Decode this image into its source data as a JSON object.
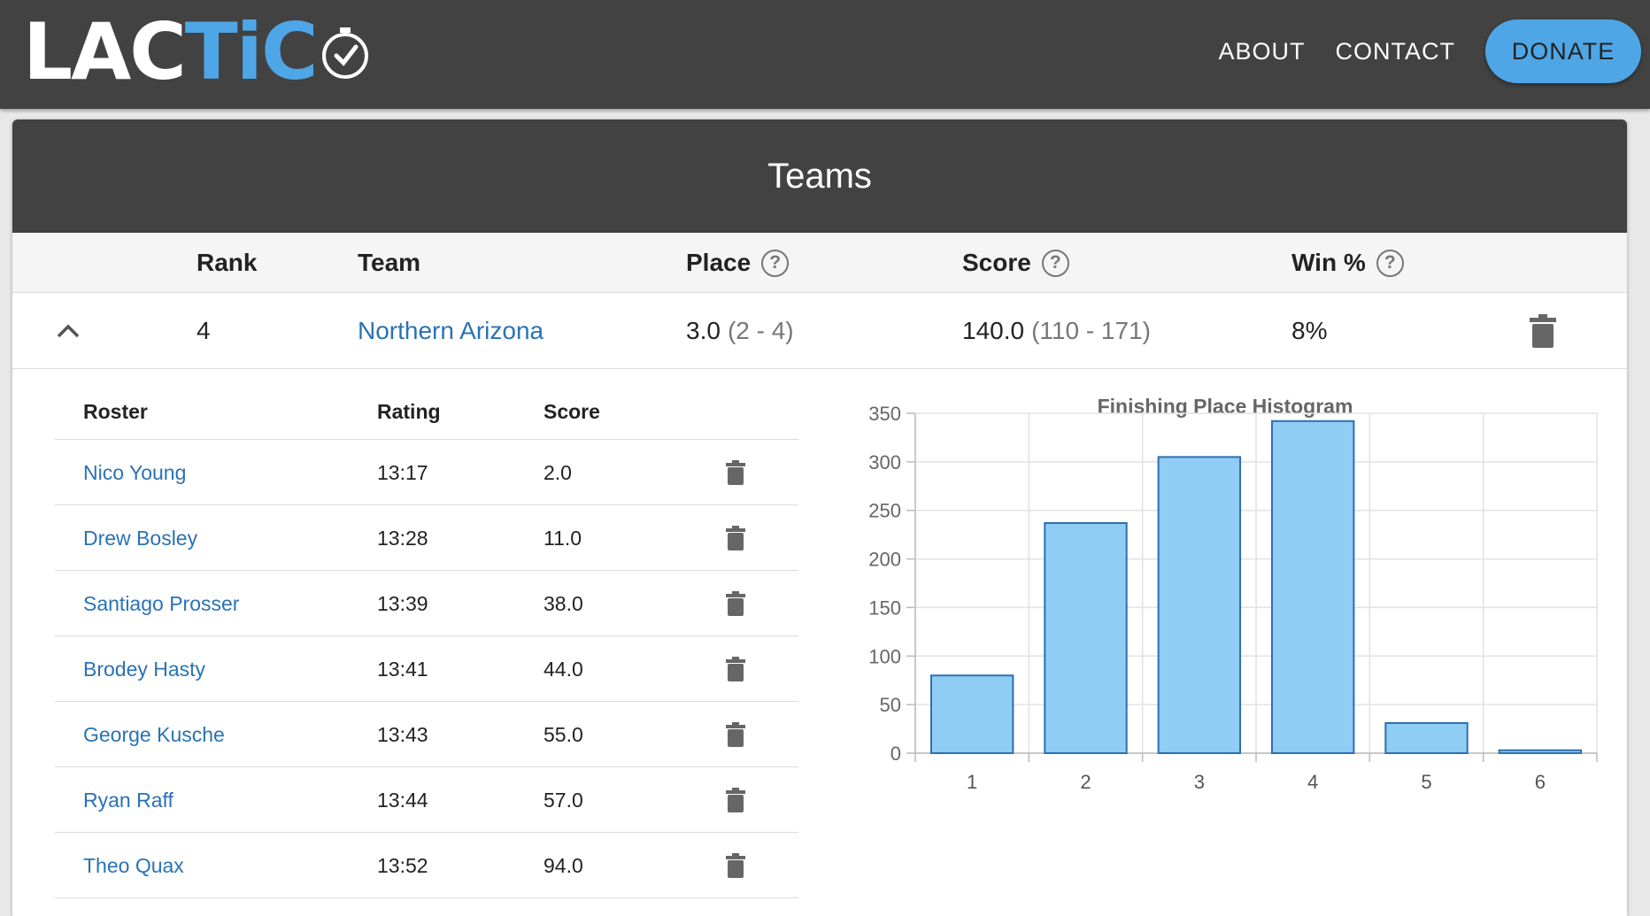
{
  "nav": {
    "logo": {
      "part1": "LA",
      "part2": "C",
      "part3": "TiC"
    },
    "links": [
      "ABOUT",
      "CONTACT"
    ],
    "donate": "DONATE"
  },
  "card": {
    "title": "Teams",
    "columns": {
      "rank": "Rank",
      "team": "Team",
      "place": "Place",
      "score": "Score",
      "win": "Win %"
    },
    "help_glyph": "?"
  },
  "team": {
    "rank": "4",
    "name": "Northern Arizona",
    "place": "3.0",
    "place_range": "(2 - 4)",
    "score": "140.0",
    "score_range": "(110 - 171)",
    "win": "8%"
  },
  "roster": {
    "headers": {
      "name": "Roster",
      "rating": "Rating",
      "score": "Score"
    },
    "rows": [
      {
        "name": "Nico Young",
        "rating": "13:17",
        "score": "2.0"
      },
      {
        "name": "Drew Bosley",
        "rating": "13:28",
        "score": "11.0"
      },
      {
        "name": "Santiago Prosser",
        "rating": "13:39",
        "score": "38.0"
      },
      {
        "name": "Brodey Hasty",
        "rating": "13:41",
        "score": "44.0"
      },
      {
        "name": "George Kusche",
        "rating": "13:43",
        "score": "55.0"
      },
      {
        "name": "Ryan Raff",
        "rating": "13:44",
        "score": "57.0"
      },
      {
        "name": "Theo Quax",
        "rating": "13:52",
        "score": "94.0"
      }
    ]
  },
  "colors": {
    "accent": "#4ea6e6",
    "bar_fill": "#90cdf4",
    "bar_stroke": "#2e6fb0",
    "link": "#2a72b5"
  },
  "chart_data": {
    "type": "bar",
    "title": "Finishing Place Histogram",
    "categories": [
      "1",
      "2",
      "3",
      "4",
      "5",
      "6"
    ],
    "values": [
      80,
      237,
      305,
      342,
      31,
      3
    ],
    "ylim": [
      0,
      350
    ],
    "yticks": [
      0,
      50,
      100,
      150,
      200,
      250,
      300,
      350
    ],
    "grid": true,
    "xlabel": "",
    "ylabel": ""
  }
}
